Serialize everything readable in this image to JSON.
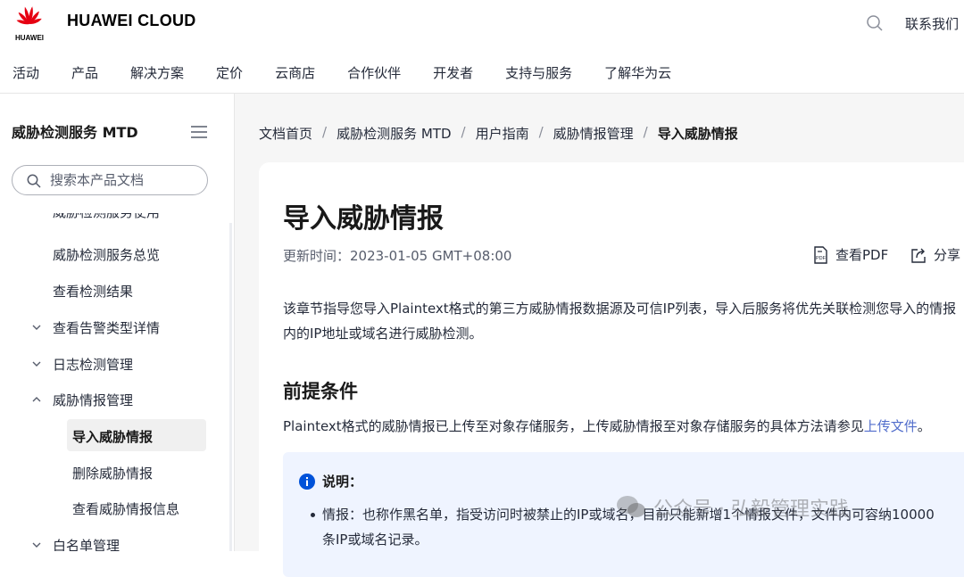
{
  "header": {
    "brand": "HUAWEI CLOUD",
    "logo_text": "HUAWEI",
    "contact": "联系我们",
    "nav": [
      "活动",
      "产品",
      "解决方案",
      "定价",
      "云商店",
      "合作伙伴",
      "开发者",
      "支持与服务",
      "了解华为云"
    ]
  },
  "sidebar": {
    "title": "威胁检测服务 MTD",
    "search_placeholder": "搜索本产品文档",
    "cut_item": "威胁检测服务使用",
    "items": [
      {
        "label": "威胁检测服务总览"
      },
      {
        "label": "查看检测结果"
      },
      {
        "label": "查看告警类型详情",
        "chevron": "down"
      },
      {
        "label": "日志检测管理",
        "chevron": "down"
      },
      {
        "label": "威胁情报管理",
        "chevron": "up"
      },
      {
        "label": "导入威胁情报",
        "active": true
      },
      {
        "label": "删除威胁情报"
      },
      {
        "label": "查看威胁情报信息"
      },
      {
        "label": "白名单管理",
        "chevron": "down"
      }
    ]
  },
  "breadcrumb": [
    "文档首页",
    "威胁检测服务 MTD",
    "用户指南",
    "威胁情报管理",
    "导入威胁情报"
  ],
  "content": {
    "title": "导入威胁情报",
    "updated": "更新时间：2023-01-05 GMT+08:00",
    "view_pdf": "查看PDF",
    "share": "分享",
    "intro": "该章节指导您导入Plaintext格式的第三方威胁情报数据源及可信IP列表，导入后服务将优先关联检测您导入的情报内的IP地址或域名进行威胁检测。",
    "prereq_title": "前提条件",
    "prereq_text": "Plaintext格式的威胁情报已上传至对象存储服务，上传威胁情报至对象存储服务的具体方法请参见",
    "prereq_link": "上传文件",
    "prereq_end": "。",
    "note_title": "说明：",
    "note_item": "情报：也称作黑名单，指受访问时被禁止的IP或域名，目前只能新增1个情报文件，文件内可容纳10000条IP或域名记录。"
  },
  "watermark": "公众号 · 弘毅管理实践",
  "colors": {
    "brand_red": "#e60012",
    "link": "#526ecc",
    "note_bg": "#eff4ff",
    "info_icon": "#0052d9"
  }
}
